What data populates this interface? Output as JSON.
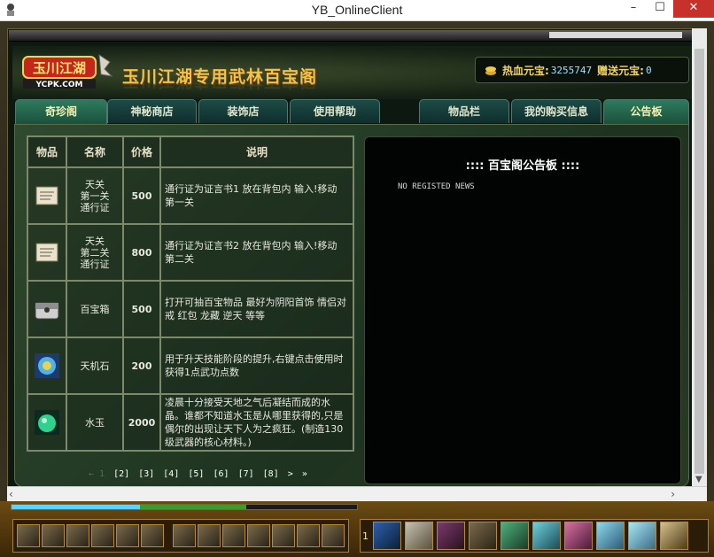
{
  "window": {
    "title": "YB_OnlineClient"
  },
  "header": {
    "logo_text": "玉川江湖",
    "logo_sub": "YCPK.COM",
    "title": "玉川江湖专用武林百宝阁",
    "balance_label": "热血元宝:",
    "balance_value": "3255747",
    "gift_label": "赠送元宝:",
    "gift_value": "0"
  },
  "tabs": [
    {
      "label": "奇珍阁",
      "active": true
    },
    {
      "label": "神秘商店"
    },
    {
      "label": "装饰店"
    },
    {
      "label": "使用帮助"
    },
    {
      "label": "物品栏"
    },
    {
      "label": "我的购买信息"
    },
    {
      "label": "公告板",
      "active": true
    }
  ],
  "table": {
    "headers": [
      "物品",
      "名称",
      "价格",
      "说明"
    ],
    "rows": [
      {
        "icon": "scroll-icon",
        "name": "天关\n第一关\n通行证",
        "price": "500",
        "desc": "通行证为证言书1 放在背包内 输入!移动 第一关"
      },
      {
        "icon": "scroll-icon",
        "name": "天关\n第二关\n通行证",
        "price": "800",
        "desc": "通行证为证言书2 放在背包内 输入!移动 第二关"
      },
      {
        "icon": "treasure-chest-icon",
        "name": "百宝箱",
        "price": "500",
        "desc": "打开可抽百宝物品 最好为阴阳首饰 情侣对戒 红包 龙藏 逆天 等等"
      },
      {
        "icon": "gem-stone-icon",
        "name": "天机石",
        "price": "200",
        "desc": "用于升天技能阶段的提升,右键点击使用时获得1点武功点数"
      },
      {
        "icon": "jade-icon",
        "name": "水玉",
        "price": "2000",
        "desc": "凌晨十分接受天地之气后凝结而成的水晶。谁都不知道水玉是从哪里获得的,只是偶尔的出现让天下人为之疯狂。(制造130级武器的核心材料。)"
      }
    ]
  },
  "pager": {
    "prefix": "← 1",
    "pages": [
      "[2]",
      "[3]",
      "[4]",
      "[5]",
      "[6]",
      "[7]",
      "[8]"
    ],
    "next": ">",
    "last": "»"
  },
  "notice": {
    "title": ":::: 百宝阁公告板 ::::",
    "body": "NO REGISTED NEWS"
  },
  "hud": {
    "page_num": "1"
  },
  "colors": {
    "accent": "#f0c34a",
    "price": "#8ce85a",
    "tab_active": "#2e7b5e"
  }
}
